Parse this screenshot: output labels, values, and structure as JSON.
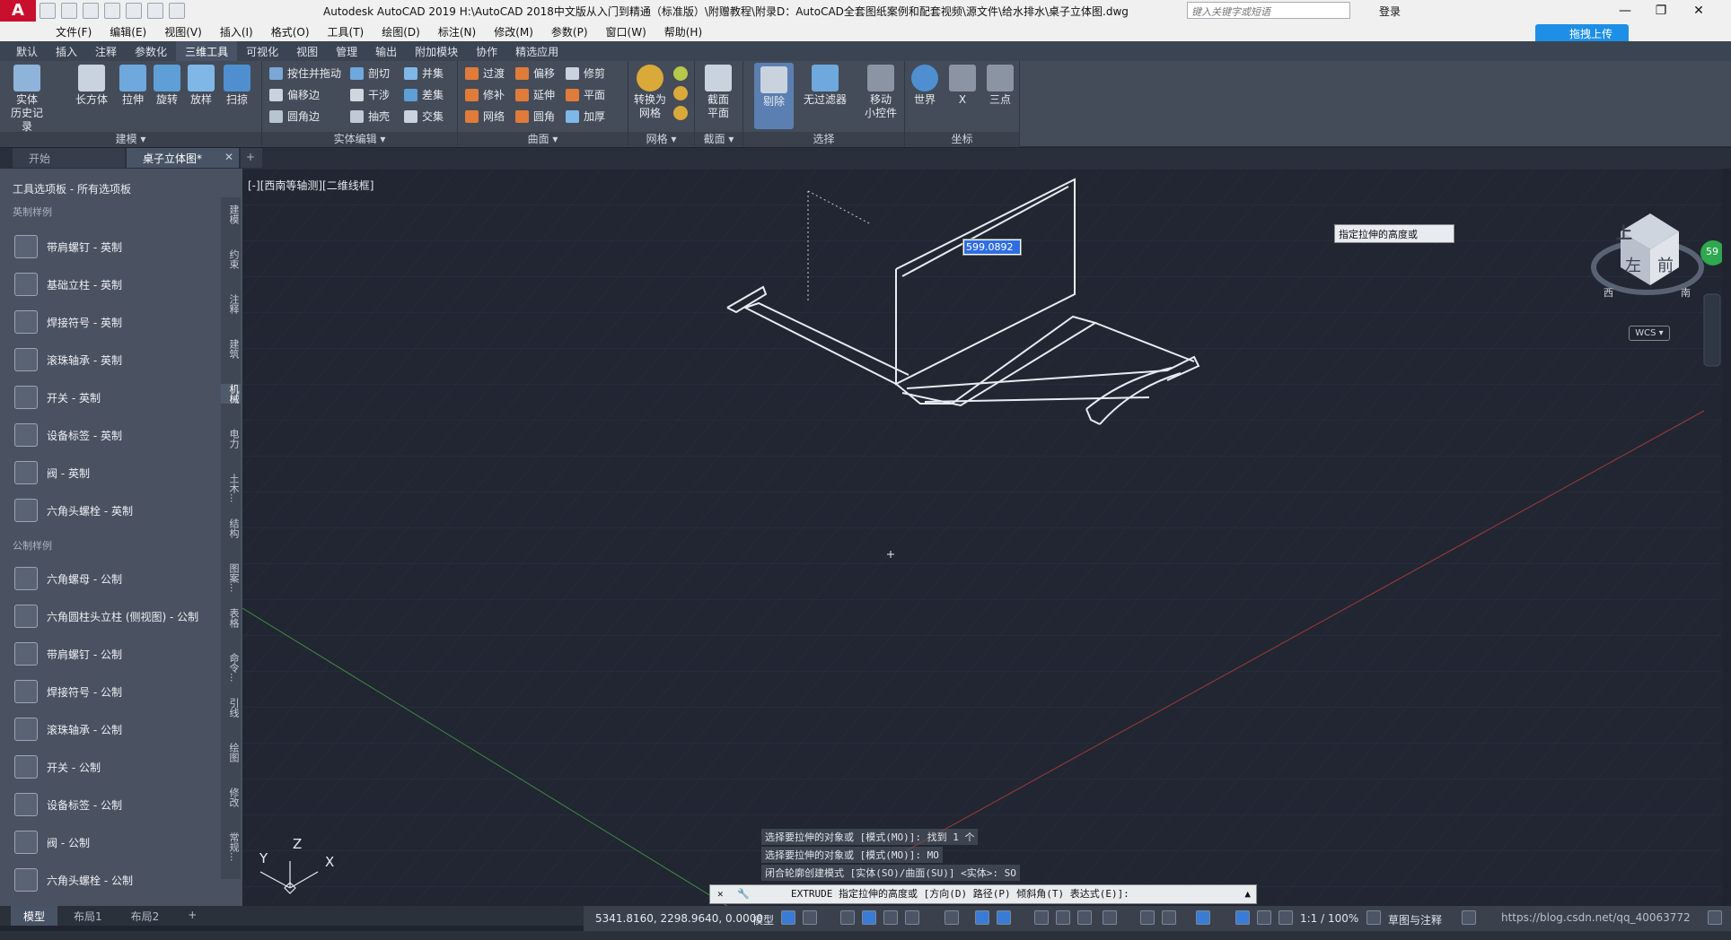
{
  "app": {
    "logo": "A",
    "title": "Autodesk AutoCAD 2019    H:\\AutoCAD 2018中文版从入门到精通（标准版）\\附赠教程\\附录D：AutoCAD全套图纸案例和配套视频\\源文件\\给水排水\\桌子立体图.dwg",
    "search_placeholder": "键入关键字或短语",
    "login": "登录",
    "upload_button": "拖拽上传"
  },
  "menu": [
    "文件(F)",
    "编辑(E)",
    "视图(V)",
    "插入(I)",
    "格式(O)",
    "工具(T)",
    "绘图(D)",
    "标注(N)",
    "修改(M)",
    "参数(P)",
    "窗口(W)",
    "帮助(H)"
  ],
  "ribbon_tabs": [
    "默认",
    "插入",
    "注释",
    "参数化",
    "三维工具",
    "可视化",
    "视图",
    "管理",
    "输出",
    "附加模块",
    "协作",
    "精选应用"
  ],
  "ribbon_active_tab": "三维工具",
  "ribbon": {
    "model": {
      "label": "建模 ▾",
      "buttons": [
        "实体\n历史记录",
        "长方体",
        "拉伸",
        "旋转",
        "放样",
        "扫掠"
      ]
    },
    "solid_edit": {
      "label": "实体编辑 ▾",
      "buttons": [
        "按住并拖动",
        "偏移边",
        "圆角边",
        "剖切",
        "干涉",
        "抽壳",
        "并集",
        "差集",
        "交集"
      ]
    },
    "surface": {
      "label": "曲面 ▾",
      "buttons": [
        "过渡",
        "修补",
        "网络",
        "偏移",
        "延伸",
        "圆角",
        "修剪",
        "平面",
        "加厚"
      ]
    },
    "mesh": {
      "label": "网格 ▾",
      "button": "转换为\n网格"
    },
    "section": {
      "label": "截面 ▾",
      "button": "截面\n平面"
    },
    "selection": {
      "label": "选择",
      "buttons": [
        "剔除",
        "无过滤器",
        "移动\n小控件"
      ]
    },
    "coords": {
      "label": "坐标",
      "buttons": [
        "世界",
        "X",
        "三点"
      ]
    }
  },
  "doc_tabs": [
    {
      "label": "开始",
      "active": false
    },
    {
      "label": "桌子立体图*",
      "active": true
    }
  ],
  "palette": {
    "title": "工具选项板 - 所有选项板",
    "sections": [
      {
        "title": "英制样例",
        "items": [
          "带肩螺钉 - 英制",
          "基础立柱 - 英制",
          "焊接符号 - 英制",
          "滚珠轴承 - 英制",
          "开关 - 英制",
          "设备标签 - 英制",
          "阀 - 英制",
          "六角头螺栓 - 英制"
        ]
      },
      {
        "title": "公制样例",
        "items": [
          "六角螺母 - 公制",
          "六角圆柱头立柱 (侧视图) - 公制",
          "带肩螺钉 - 公制",
          "焊接符号 - 公制",
          "滚珠轴承 - 公制",
          "开关 - 公制",
          "设备标签 - 公制",
          "阀 - 公制",
          "六角头螺栓 - 公制"
        ]
      }
    ],
    "side_tabs": [
      "建模",
      "约束",
      "注释",
      "建筑",
      "机械",
      "电力",
      "土木...",
      "结构",
      "图案...",
      "表格",
      "命令...",
      "引线",
      "绘图",
      "修改",
      "常规..."
    ]
  },
  "viewport": {
    "label": "[-][西南等轴测][二维线框]",
    "dyn_input": "599.0892",
    "tooltip": "指定拉伸的高度或",
    "wcs": "WCS ▾",
    "viewcube": {
      "top": "上",
      "left": "左",
      "front": "前",
      "west": "西",
      "south": "南"
    },
    "ucs": {
      "y": "Y",
      "z": "Z",
      "x": "X"
    }
  },
  "command": {
    "history": [
      "选择要拉伸的对象或 [模式(MO)]: 找到 1 个",
      "选择要拉伸的对象或 [模式(MO)]: MO",
      "闭合轮廓创建模式 [实体(SO)/曲面(SU)] <实体>: SO"
    ],
    "current": "EXTRUDE 指定拉伸的高度或 [方向(D) 路径(P) 倾斜角(T) 表达式(E)]:"
  },
  "layout_tabs": [
    {
      "label": "模型",
      "active": true
    },
    {
      "label": "布局1",
      "active": false
    },
    {
      "label": "布局2",
      "active": false
    }
  ],
  "status": {
    "coords": "5341.8160, 2298.9640, 0.0000",
    "mode": "模型",
    "scale": "1:1 / 100%",
    "workspace": "草图与注释",
    "watermark": "https://blog.csdn.net/qq_40063772",
    "badge": "59"
  }
}
